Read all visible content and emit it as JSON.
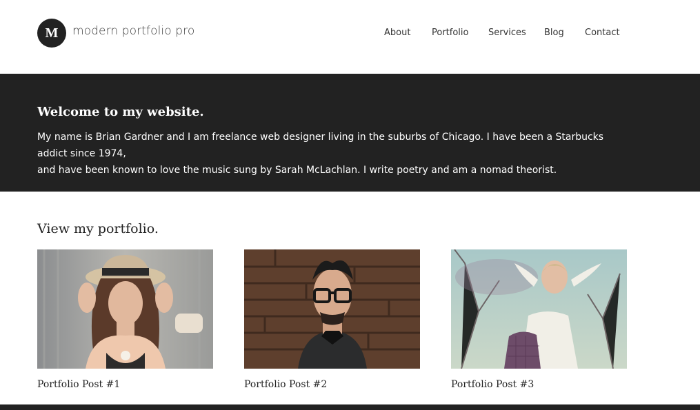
{
  "header": {
    "logo_letter": "M",
    "site_title": "modern portfolio pro",
    "nav": [
      "About",
      "Portfolio",
      "Services",
      "Blog",
      "Contact"
    ]
  },
  "hero": {
    "title": "Welcome to my website.",
    "text_line1": "My name is Brian Gardner and I am freelance web designer living in the suburbs of Chicago. I have been a Starbucks addict since 1974,",
    "text_line2": "and have been known to love the music sung by Sarah McLachlan. I write poetry and am a nomad theorist."
  },
  "portfolio": {
    "heading": "View my portfolio.",
    "items": [
      {
        "title": "Portfolio Post #1",
        "image": "woman-in-hat-photo"
      },
      {
        "title": "Portfolio Post #2",
        "image": "man-with-glasses-photo"
      },
      {
        "title": "Portfolio Post #3",
        "image": "woman-outdoors-photo"
      }
    ]
  },
  "colors": {
    "dark": "#222222",
    "text": "#333333",
    "white": "#ffffff"
  }
}
